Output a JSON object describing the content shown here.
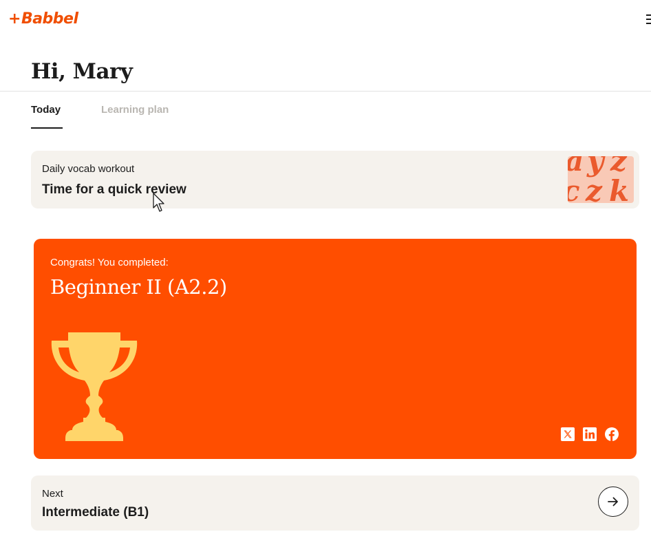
{
  "app": {
    "logo_text": "Babbel",
    "logo_color": "#f04e00"
  },
  "header": {
    "menu_icon": "hamburger-menu-icon"
  },
  "greeting": "Hi, Mary",
  "tabs": [
    {
      "label": "Today",
      "active": true
    },
    {
      "label": "Learning plan",
      "active": false
    }
  ],
  "vocab_card": {
    "subtitle": "Daily vocab workout",
    "title": "Time for a quick review",
    "thumbnail_letters": [
      "a",
      "y",
      "z",
      "c",
      "z",
      "k"
    ]
  },
  "congrats_card": {
    "subtitle": "Congrats! You completed:",
    "title": "Beginner II (A2.2)",
    "background_color": "#ff4e00",
    "trophy_color": "#ffd56a",
    "share_icons": [
      "x-icon",
      "linkedin-icon",
      "facebook-icon"
    ]
  },
  "next_card": {
    "subtitle": "Next",
    "title": "Intermediate (B1)",
    "arrow_icon": "arrow-right-icon"
  }
}
